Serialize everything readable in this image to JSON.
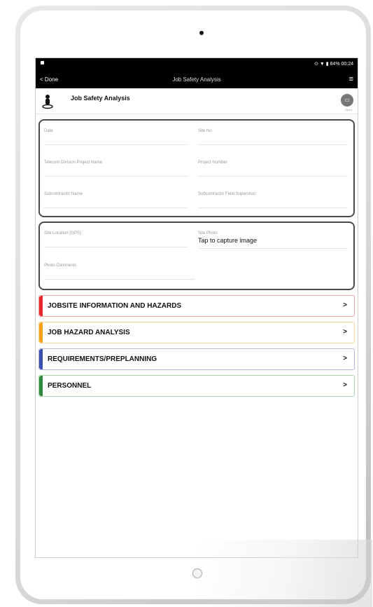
{
  "status_bar": {
    "right_text": "⊙ ▼ ▮ 84% 00:24"
  },
  "nav": {
    "back_label": "< Done",
    "title": "Job Safety Analysis",
    "menu_icon": "≡"
  },
  "header": {
    "title": "Job Safety Analysis",
    "open_label": "Open"
  },
  "form1": {
    "date": "Date",
    "site_no": "Site No.",
    "project_name": "Telecom Division Project Name",
    "project_number": "Project Number",
    "subcontractor_name": "Subcontractor Name",
    "field_supervisor": "Subcontractor Field Supervisor"
  },
  "form2": {
    "site_location": "Site Location (GPS)",
    "site_photo": "Site Photo",
    "site_photo_value": "Tap to capture image",
    "photo_comments": "Photo Comments"
  },
  "sections": [
    {
      "label": "JOBSITE INFORMATION AND HAZARDS",
      "color": "#e8262b",
      "border": "#f2a6a6"
    },
    {
      "label": "JOB HAZARD ANALYSIS",
      "color": "#f5a11a",
      "border": "#f7d59d"
    },
    {
      "label": "REQUIREMENTS/PREPLANNING",
      "color": "#3a4fb0",
      "border": "#b3b8e0"
    },
    {
      "label": "PERSONNEL",
      "color": "#2d8a3c",
      "border": "#a9d6ae"
    }
  ],
  "chevron": ">"
}
